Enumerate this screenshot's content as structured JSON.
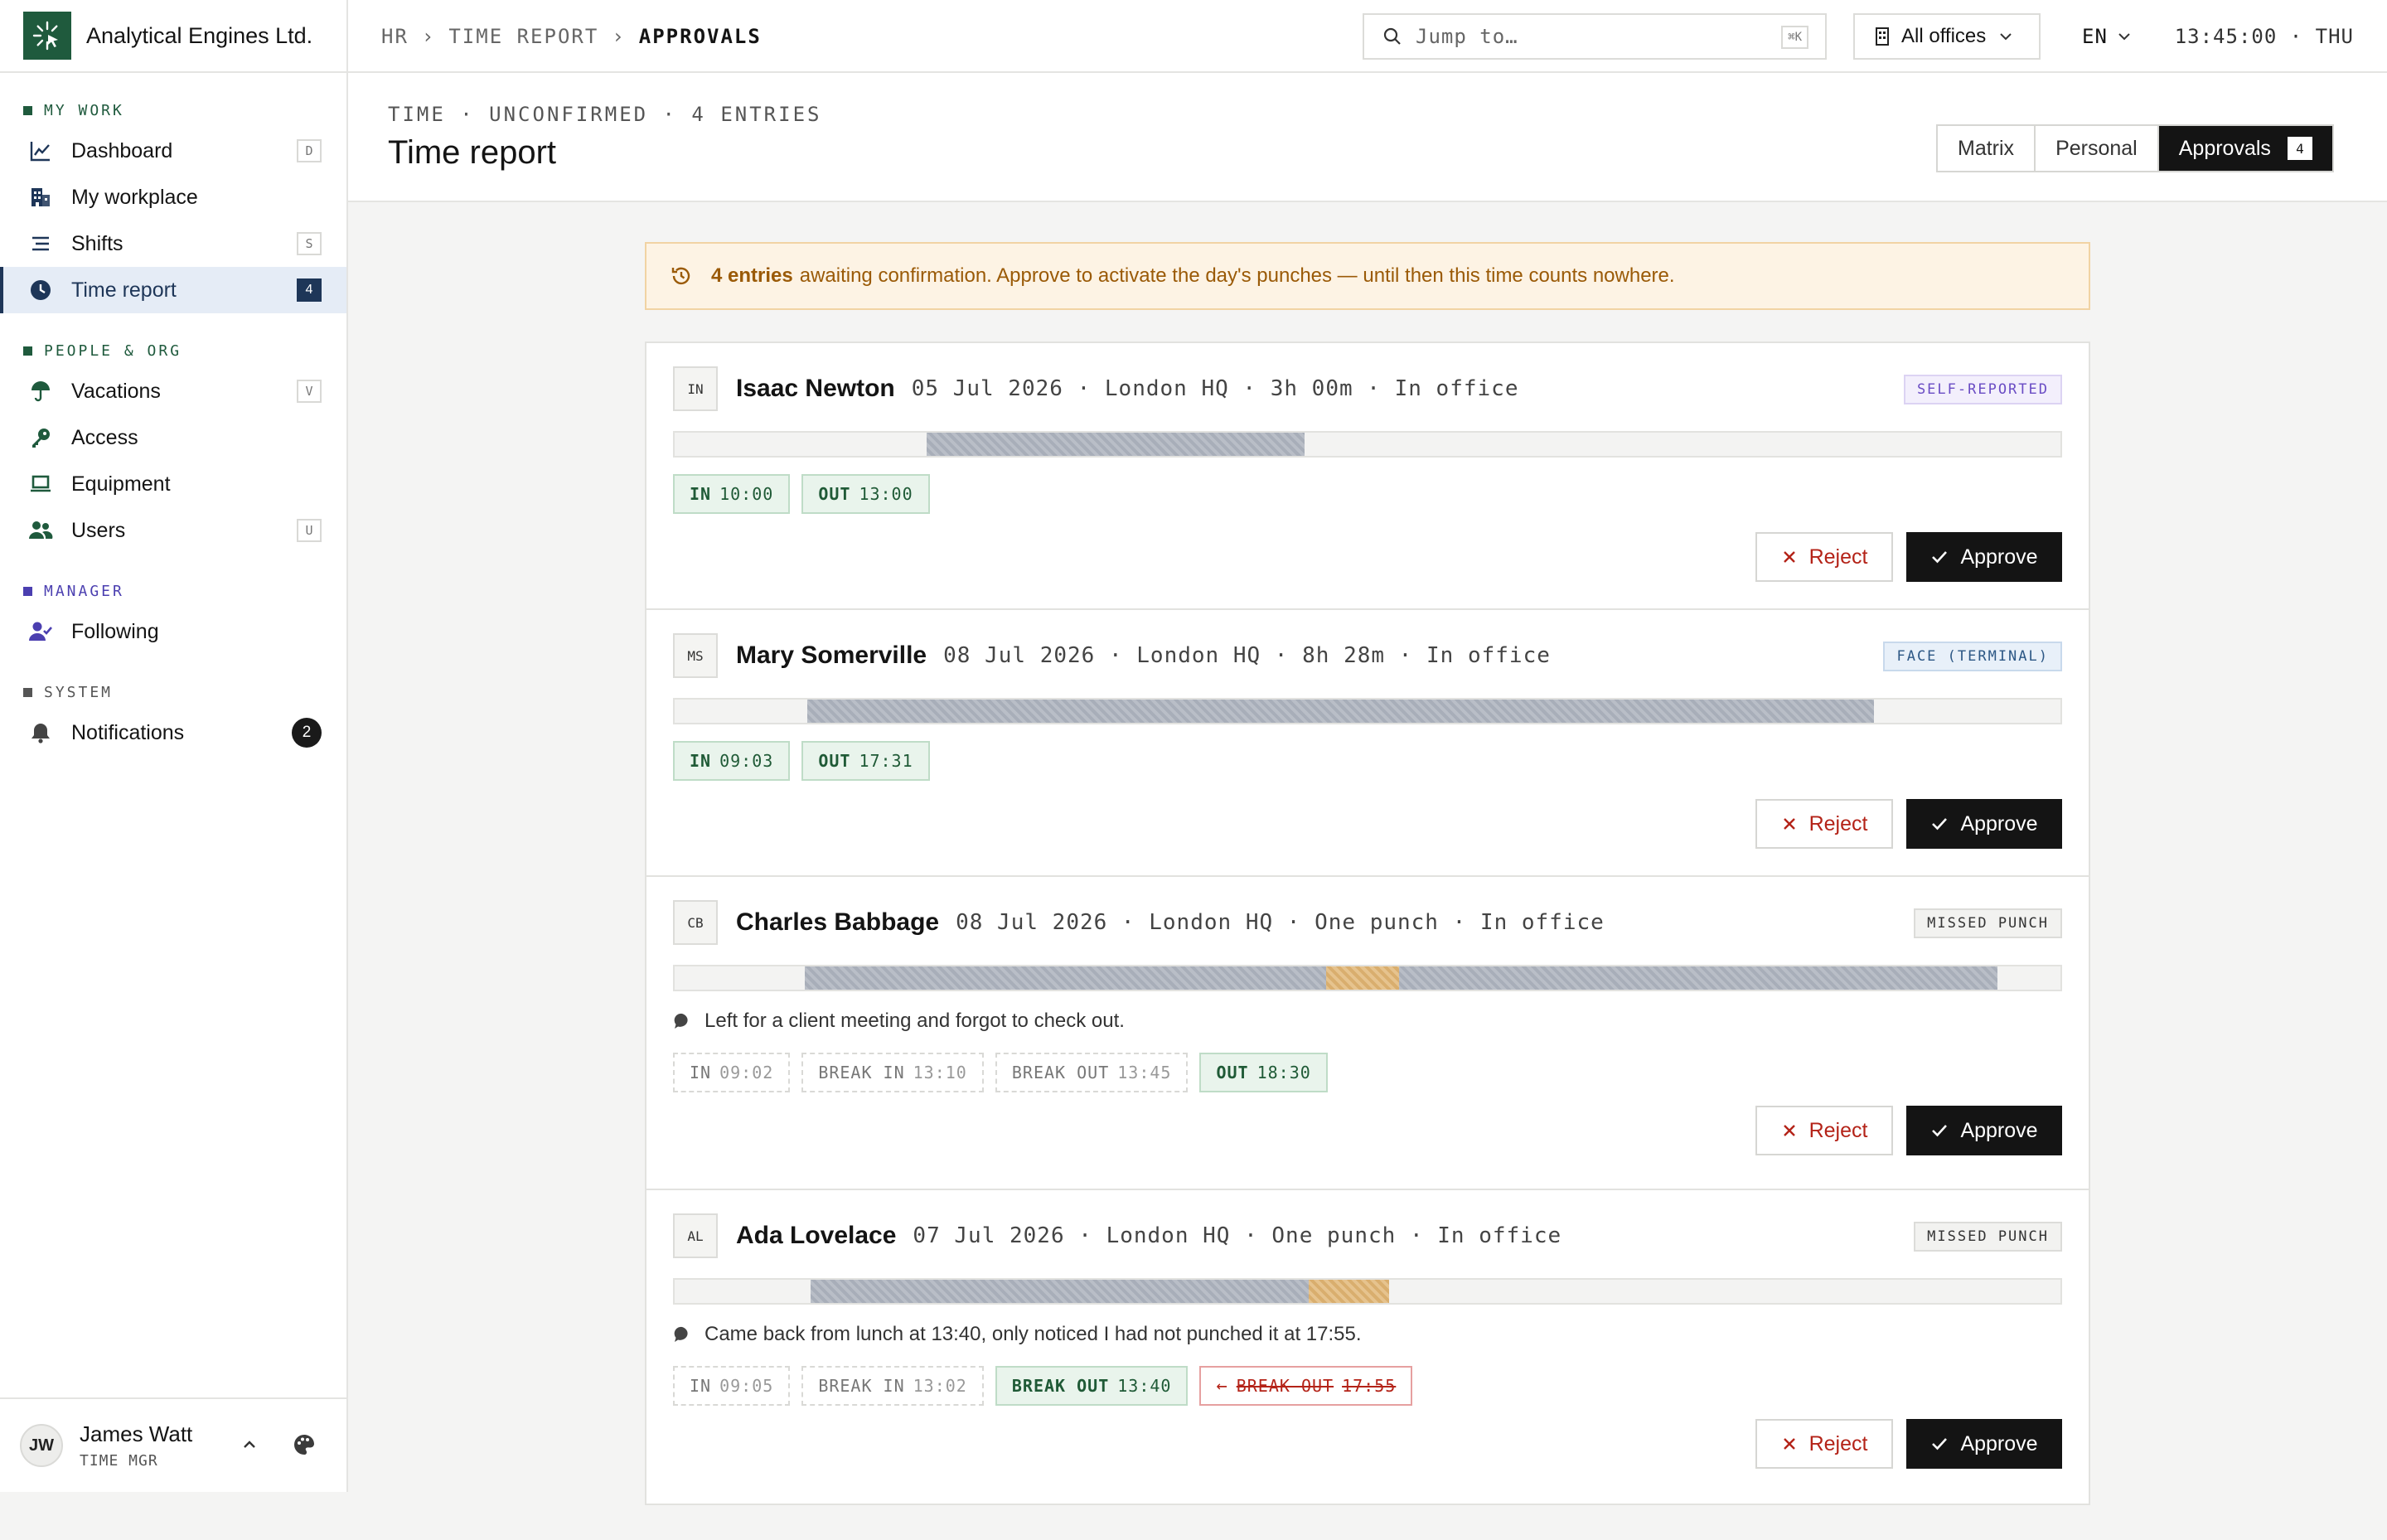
{
  "app": {
    "name": "Analytical Engines Ltd."
  },
  "colors": {
    "brand": "#1f5a3d",
    "accent": "#1e3658",
    "warning": "#9a5a07",
    "danger": "#b42318",
    "success": "#1f5a36"
  },
  "sidebar": {
    "sections": [
      {
        "label": "MY WORK",
        "color": "#1f5a3d",
        "icon": "square-icon"
      },
      {
        "label": "PEOPLE & ORG",
        "color": "#1f5a3d",
        "icon": "square-icon"
      },
      {
        "label": "MANAGER",
        "color": "#4b3fb0",
        "icon": "square-icon"
      },
      {
        "label": "SYSTEM",
        "color": "#555555",
        "icon": "square-icon"
      }
    ],
    "items": [
      {
        "label": "Dashboard",
        "icon": "chart-line-icon",
        "shortcut": "D"
      },
      {
        "label": "My workplace",
        "icon": "building-icon"
      },
      {
        "label": "Shifts",
        "icon": "list-icon",
        "shortcut": "S"
      },
      {
        "label": "Time report",
        "icon": "clock-icon",
        "count": "4",
        "active": true
      },
      {
        "label": "Vacations",
        "icon": "umbrella-icon",
        "shortcut": "V"
      },
      {
        "label": "Access",
        "icon": "key-icon"
      },
      {
        "label": "Equipment",
        "icon": "laptop-icon"
      },
      {
        "label": "Users",
        "icon": "users-icon",
        "shortcut": "U"
      },
      {
        "label": "Following",
        "icon": "user-check-icon"
      },
      {
        "label": "Notifications",
        "icon": "bell-icon",
        "count": "2"
      }
    ],
    "user": {
      "initials": "JW",
      "name": "James Watt",
      "role": "TIME MGR"
    }
  },
  "topbar": {
    "breadcrumb": [
      "HR",
      "TIME REPORT",
      "APPROVALS"
    ],
    "breadcrumb_separator": "›",
    "search": {
      "placeholder": "Jump to…",
      "shortcut": "⌘K"
    },
    "office_filter": "All offices",
    "language": "EN",
    "clock": "13:45:00 · THU"
  },
  "header": {
    "subtitle": "TIME · UNCONFIRMED · 4 ENTRIES",
    "title": "Time report",
    "tabs": [
      {
        "label": "Matrix"
      },
      {
        "label": "Personal"
      },
      {
        "label": "Approvals",
        "badge": "4",
        "active": true
      }
    ]
  },
  "banner": {
    "icon": "history-icon",
    "bold": "4 entries",
    "text": "awaiting confirmation. Approve to activate the day's punches — until then this time counts nowhere."
  },
  "actions": {
    "reject_label": "Reject",
    "approve_label": "Approve"
  },
  "entries": [
    {
      "initials": "IN",
      "name": "Isaac Newton",
      "meta": "05 Jul 2026 · London HQ · 3h 00m · In office",
      "tag": "SELF-REPORTED",
      "tag_kind": "self",
      "timeline": {
        "work": [
          [
            10.0,
            13.0
          ]
        ],
        "break": []
      },
      "punches": [
        {
          "kind": "IN",
          "time": "10:00",
          "state": "ok"
        },
        {
          "kind": "OUT",
          "time": "13:00",
          "state": "ok"
        }
      ]
    },
    {
      "initials": "MS",
      "name": "Mary Somerville",
      "meta": "08 Jul 2026 · London HQ · 8h 28m · In office",
      "tag": "FACE (TERMINAL)",
      "tag_kind": "face",
      "timeline": {
        "work": [
          [
            9.05,
            17.52
          ]
        ],
        "break": []
      },
      "punches": [
        {
          "kind": "IN",
          "time": "09:03",
          "state": "ok"
        },
        {
          "kind": "OUT",
          "time": "17:31",
          "state": "ok"
        }
      ]
    },
    {
      "initials": "CB",
      "name": "Charles Babbage",
      "meta": "08 Jul 2026 · London HQ · One punch · In office",
      "tag": "MISSED PUNCH",
      "tag_kind": "miss",
      "timeline": {
        "work": [
          [
            9.03,
            13.17
          ],
          [
            13.75,
            18.5
          ]
        ],
        "break": [
          [
            13.17,
            13.75
          ]
        ]
      },
      "note": "Left for a client meeting and forgot to check out.",
      "punches": [
        {
          "kind": "IN",
          "time": "09:02",
          "state": "pend"
        },
        {
          "kind": "BREAK IN",
          "time": "13:10",
          "state": "pend"
        },
        {
          "kind": "BREAK OUT",
          "time": "13:45",
          "state": "pend"
        },
        {
          "kind": "OUT",
          "time": "18:30",
          "state": "ok"
        }
      ]
    },
    {
      "initials": "AL",
      "name": "Ada Lovelace",
      "meta": "07 Jul 2026 · London HQ · One punch · In office",
      "tag": "MISSED PUNCH",
      "tag_kind": "miss",
      "timeline": {
        "work": [
          [
            9.08,
            13.03
          ]
        ],
        "break": [
          [
            13.03,
            13.67
          ]
        ]
      },
      "note": "Came back from lunch at 13:40, only noticed I had not punched it at 17:55.",
      "punches": [
        {
          "kind": "IN",
          "time": "09:05",
          "state": "pend"
        },
        {
          "kind": "BREAK IN",
          "time": "13:02",
          "state": "pend"
        },
        {
          "kind": "BREAK OUT",
          "time": "13:40",
          "state": "ok"
        },
        {
          "kind": "BREAK OUT",
          "time": "17:55",
          "state": "rej"
        }
      ]
    }
  ]
}
